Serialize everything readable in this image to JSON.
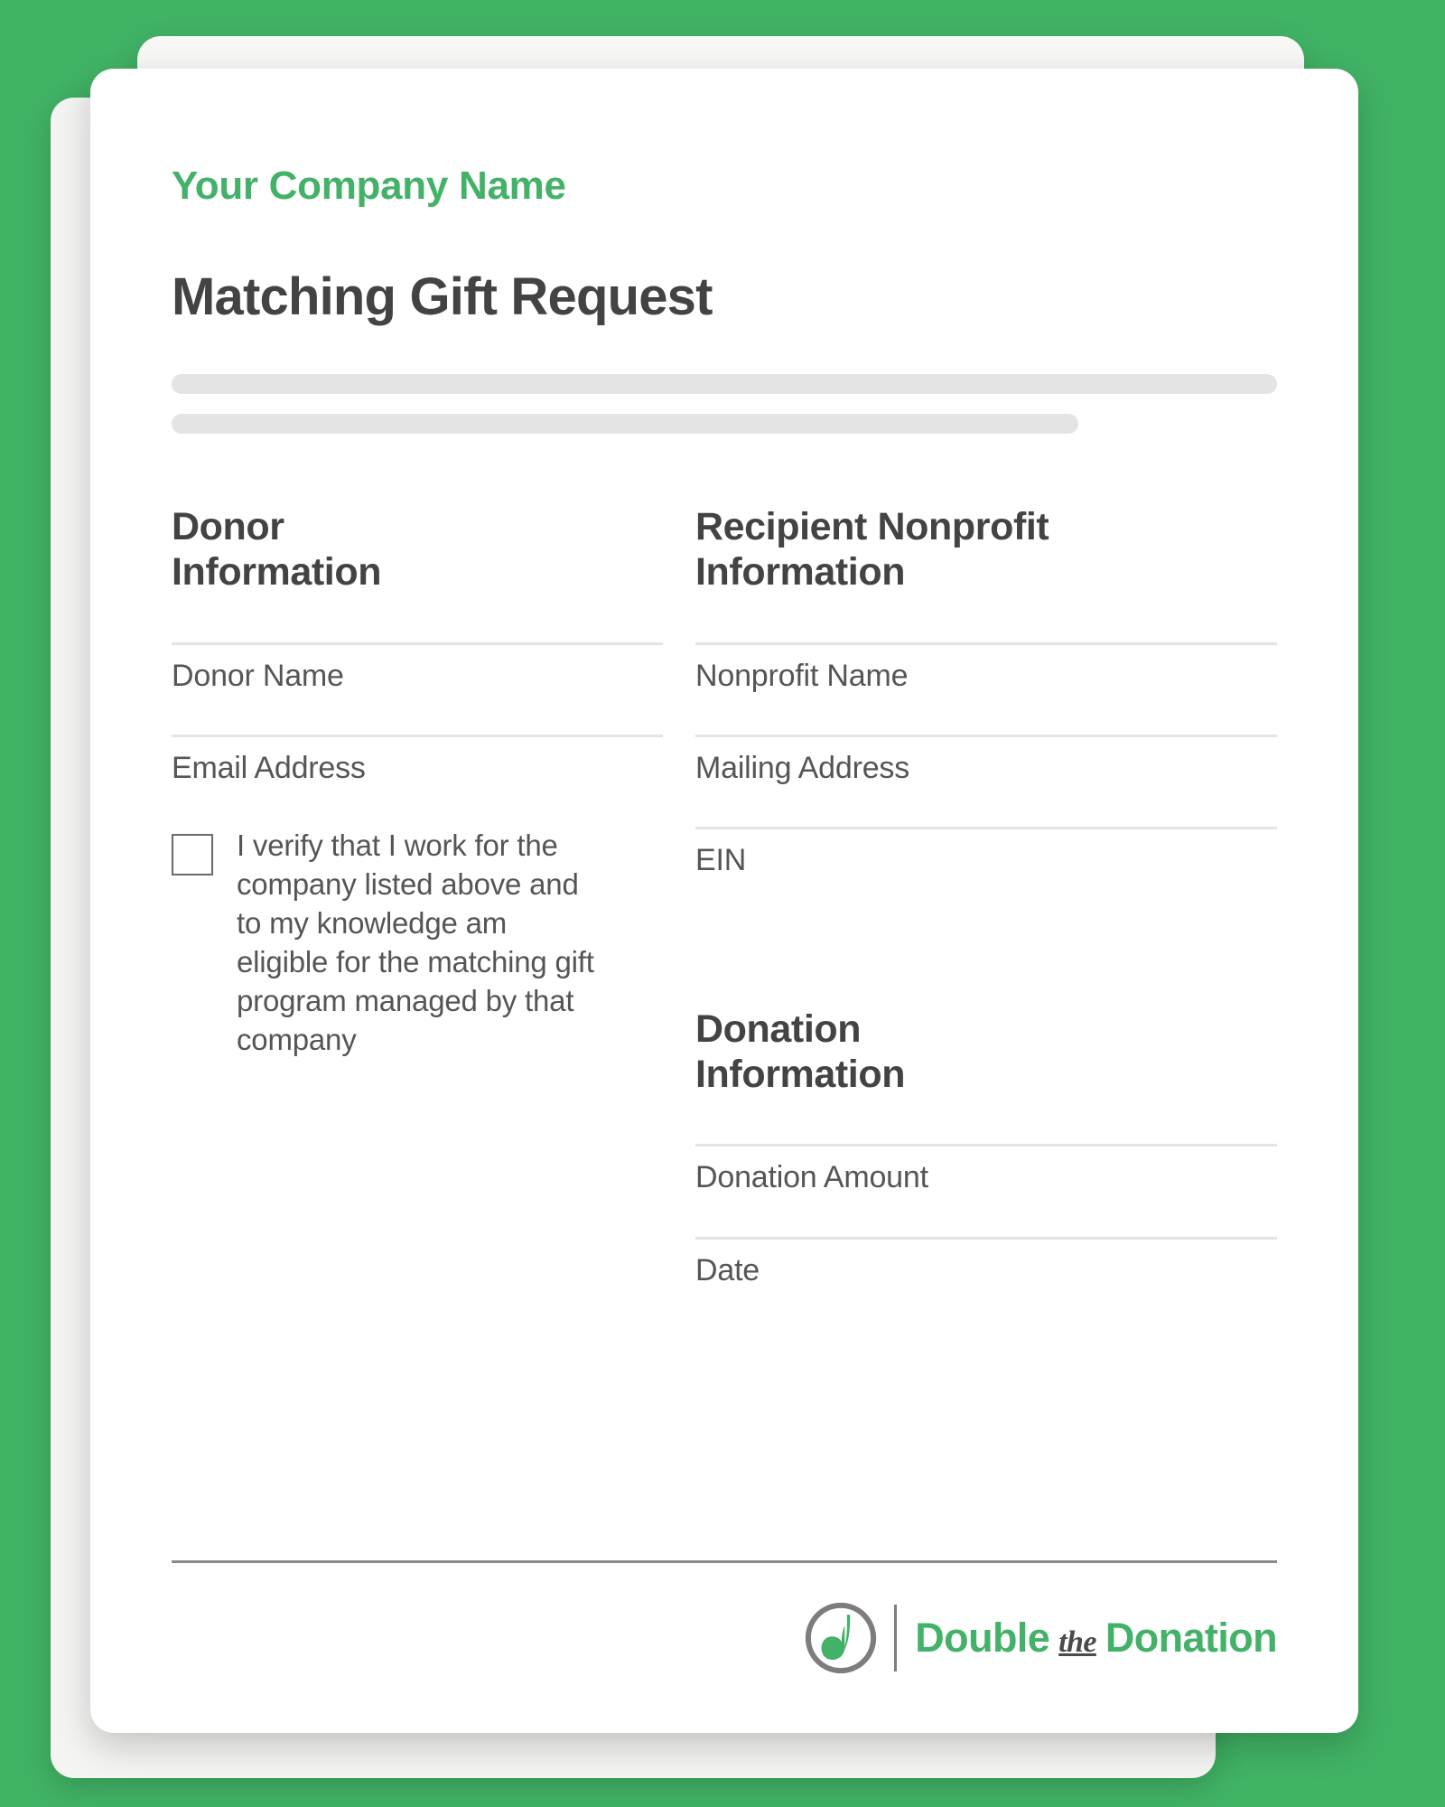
{
  "theme": {
    "background_green": "#41b365",
    "brand_green": "#43b268",
    "heading_gray": "#434343",
    "label_gray": "#555555",
    "rule_gray": "#e4e4e4",
    "footer_rule_gray": "#8a8a8a"
  },
  "header": {
    "company_name": "Your Company Name",
    "form_title": "Matching Gift Request"
  },
  "donor_section": {
    "heading": "Donor\nInformation",
    "fields": [
      {
        "label": "Donor Name"
      },
      {
        "label": "Email Address"
      }
    ],
    "verification": {
      "checked": false,
      "text": "I verify that I work for the company listed above and to my knowledge am eligible for the matching gift program managed by that company"
    }
  },
  "recipient_section": {
    "heading": "Recipient Nonprofit\nInformation",
    "fields": [
      {
        "label": "Nonprofit Name"
      },
      {
        "label": "Mailing Address"
      },
      {
        "label": "EIN"
      }
    ]
  },
  "donation_section": {
    "heading": "Donation\nInformation",
    "fields": [
      {
        "label": "Donation Amount"
      },
      {
        "label": "Date"
      }
    ]
  },
  "footer": {
    "logo": {
      "icon": "double-the-donation-logo-icon",
      "word_first": "Double",
      "word_script": "the",
      "word_last": "Donation"
    }
  }
}
